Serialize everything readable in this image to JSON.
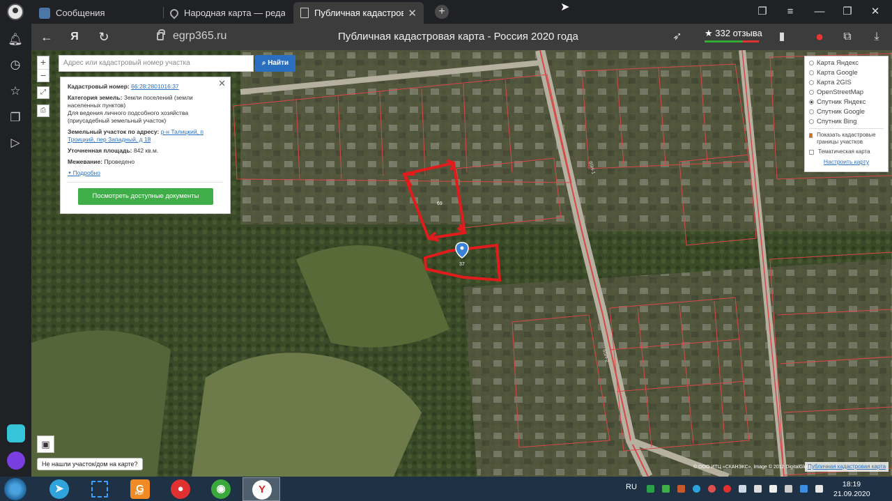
{
  "tabs": [
    {
      "title": "Сообщения",
      "color": "#4a76a8"
    },
    {
      "title": "Народная карта — редакт",
      "color": "#666666"
    },
    {
      "title": "Публичная кадастровая",
      "color": "#cccccc"
    }
  ],
  "address_bar": {
    "url": "egrp365.ru",
    "yandex_glyph": "Я",
    "page_title": "Публичная кадастровая карта - Россия 2020 года",
    "rating": "★ 332 отзыва",
    "rating_share": 0.7
  },
  "map": {
    "search_placeholder": "Адрес или кадастровый номер участка",
    "search_button": "Найти",
    "zoom_in": "+",
    "zoom_out": "−",
    "info": {
      "cadastral_label": "Кадастровый номер:",
      "cadastral_value": "66:28:2801016:37",
      "category_label": "Категория земель:",
      "category_value": "Земли поселений (земли населенных пунктов)",
      "category_use": "Для ведения личного подсобного хозяйства (приусадебный земельный участок)",
      "address_label": "Земельный участок по адресу:",
      "address_value": "р-н Талицкий, п Троицкий, пер Западный, д 18",
      "area_label": "Уточненная площадь:",
      "area_value": "842 кв.м.",
      "survey_label": "Межевание:",
      "survey_value": "Проведено",
      "more_link": "Подробно",
      "docs_button": "Посмотреть доступные документы"
    },
    "layers": {
      "options": [
        {
          "label": "Карта Яндекс",
          "selected": false
        },
        {
          "label": "Карта Google",
          "selected": false
        },
        {
          "label": "Карта 2GIS",
          "selected": false
        },
        {
          "label": "OpenStreetMap",
          "selected": false
        },
        {
          "label": "Спутник Яндекс",
          "selected": true
        },
        {
          "label": "Спутник Google",
          "selected": false
        },
        {
          "label": "Спутник Bing",
          "selected": false
        }
      ],
      "show_borders": "Показать кадастровые границы участков",
      "thematic": "Тематическая карта",
      "setup_link": "Настроить карту"
    },
    "not_found": "Не нашли участок/дом на карте?",
    "copyright": "© ООО ИТЦ «СКАНЭКС», Image © 2012 DigitalGlobe",
    "pkk_link": "Публичная кадастровая карта",
    "labels": {
      "marker_plot": "37",
      "plot_north": "69",
      "road_a": "65Н-1",
      "road_b": "65Н-2"
    }
  },
  "taskbar": {
    "lang": "RU",
    "time": "18:19",
    "date": "21.09.2020",
    "yandex_app": "Y",
    "pdf_app": "G",
    "pdf_label": "PDF"
  }
}
